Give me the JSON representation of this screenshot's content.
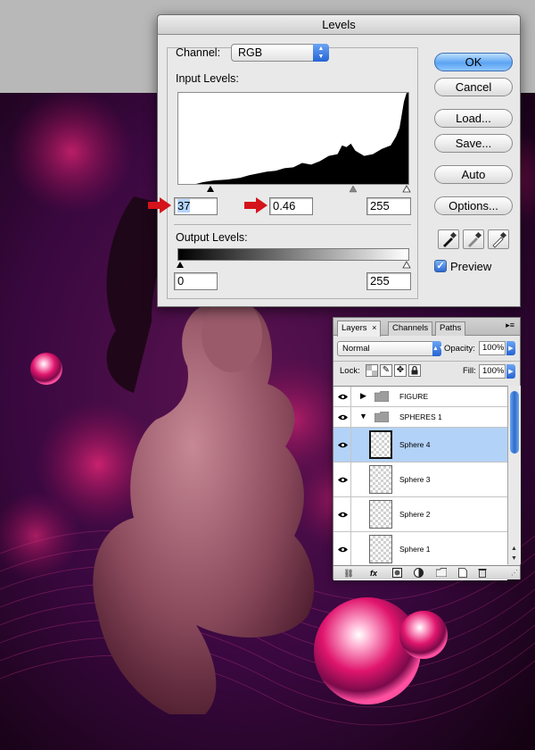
{
  "levels_dialog": {
    "title": "Levels",
    "channel_label": "Channel:",
    "channel_value": "RGB",
    "input_levels_label": "Input Levels:",
    "input_black": "37",
    "input_gamma": "0.46",
    "input_white": "255",
    "output_levels_label": "Output Levels:",
    "output_black": "0",
    "output_white": "255",
    "buttons": {
      "ok": "OK",
      "cancel": "Cancel",
      "load": "Load...",
      "save": "Save...",
      "auto": "Auto",
      "options": "Options..."
    },
    "preview_label": "Preview",
    "preview_checked": true
  },
  "layers_panel": {
    "tabs": [
      "Layers",
      "Channels",
      "Paths"
    ],
    "tab_close": "×",
    "blend_mode": "Normal",
    "opacity_label": "Opacity:",
    "opacity_value": "100%",
    "lock_label": "Lock:",
    "fill_label": "Fill:",
    "fill_value": "100%",
    "layers": [
      {
        "name": "FIGURE",
        "type": "group",
        "visible": true,
        "expanded": false
      },
      {
        "name": "SPHERES 1",
        "type": "group",
        "visible": true,
        "expanded": true
      },
      {
        "name": "Sphere 4",
        "type": "layer",
        "visible": true,
        "selected": true
      },
      {
        "name": "Sphere 3",
        "type": "layer",
        "visible": true
      },
      {
        "name": "Sphere 2",
        "type": "layer",
        "visible": true
      },
      {
        "name": "Sphere 1",
        "type": "layer",
        "visible": true
      }
    ],
    "footer_fx": "fx"
  },
  "colors": {
    "accent_blue": "#2a6cd6",
    "selection_blue": "#b3d2f7",
    "annotation_arrow": "#d4131b",
    "artwork_magenta": "#e5156f",
    "artwork_purple": "#3a0840"
  }
}
